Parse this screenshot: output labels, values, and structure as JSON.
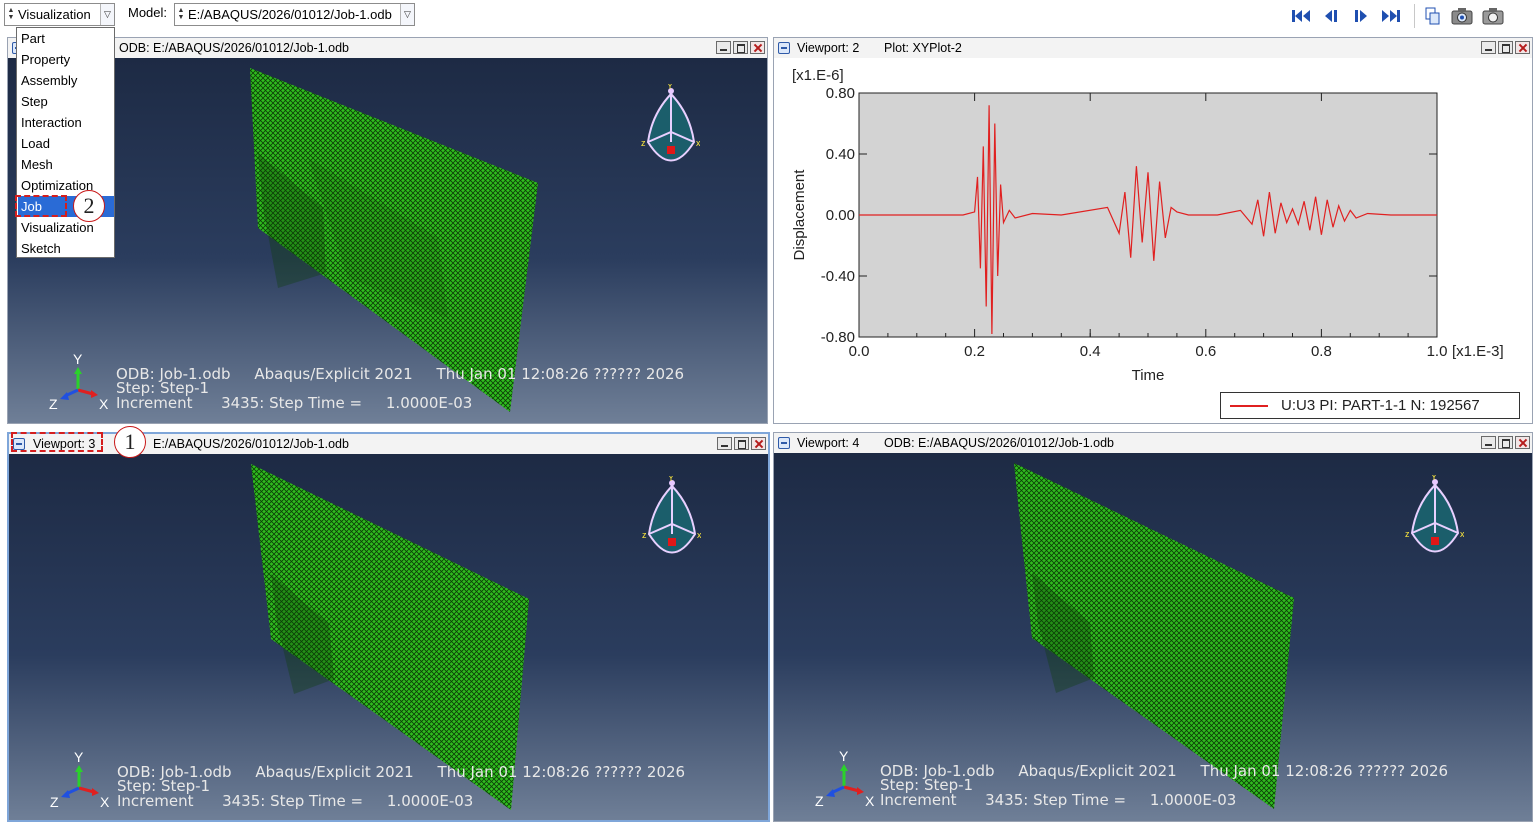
{
  "toolbar": {
    "module_value": "Visualization",
    "model_label": "Model:",
    "model_value": "E:/ABAQUS/2026/01012/Job-1.odb"
  },
  "module_menu": {
    "items": [
      "Part",
      "Property",
      "Assembly",
      "Step",
      "Interaction",
      "Load",
      "Mesh",
      "Optimization",
      "Job",
      "Visualization",
      "Sketch"
    ],
    "selected": "Job"
  },
  "annotations": {
    "callout_1": "1",
    "callout_2": "2",
    "color": "#d41e1e"
  },
  "viewports": {
    "vp1": {
      "title": "ODB: E:/ABAQUS/2026/01012/Job-1.odb",
      "info": {
        "line1": "ODB: Job-1.odb     Abaqus/Explicit 2021     Thu Jan 01 12:08:26 ?????? 2026",
        "line2": "Step: Step-1",
        "line3": "Increment      3435: Step Time =     1.0000E-03"
      }
    },
    "vp2": {
      "title_name": "Viewport: 2",
      "title_plot": "Plot: XYPlot-2"
    },
    "vp3": {
      "title_name": "Viewport: 3",
      "title_odb": "E:/ABAQUS/2026/01012/Job-1.odb",
      "info": {
        "line1": "ODB: Job-1.odb     Abaqus/Explicit 2021     Thu Jan 01 12:08:26 ?????? 2026",
        "line2": "Step: Step-1",
        "line3": "Increment      3435: Step Time =     1.0000E-03"
      }
    },
    "vp4": {
      "title_name": "Viewport: 4",
      "title_odb": "ODB: E:/ABAQUS/2026/01012/Job-1.odb",
      "info": {
        "line1": "ODB: Job-1.odb     Abaqus/Explicit 2021     Thu Jan 01 12:08:26 ?????? 2026",
        "line2": "Step: Step-1",
        "line3": "Increment      3435: Step Time =     1.0000E-03"
      }
    }
  },
  "triad": {
    "x": "X",
    "y": "Y",
    "z": "Z"
  },
  "view_cube": {
    "x": "x",
    "y": "Y",
    "z": "z"
  },
  "icons": [
    "first-frame-icon",
    "previous-frame-icon",
    "next-frame-icon",
    "last-frame-icon",
    "copy-icon",
    "camera-icon",
    "snapshot-icon"
  ],
  "chart_data": {
    "type": "line",
    "title": "",
    "xlabel": "Time",
    "ylabel": "Displacement",
    "x_scale": "[x1.E-3]",
    "y_scale": "[x1.E-6]",
    "xlim": [
      0.0,
      1.0
    ],
    "ylim": [
      -0.8,
      0.8
    ],
    "x_ticks": [
      "0.0",
      "0.2",
      "0.4",
      "0.6",
      "0.8",
      "1.0"
    ],
    "y_ticks": [
      "0.80",
      "0.40",
      "0.00",
      "-0.40",
      "-0.80"
    ],
    "grid": false,
    "legend": "bottom-right",
    "series": [
      {
        "name": "U:U3 PI: PART-1-1 N: 192567",
        "color": "#e02020",
        "x": [
          0.0,
          0.18,
          0.2,
          0.205,
          0.21,
          0.215,
          0.22,
          0.225,
          0.23,
          0.235,
          0.24,
          0.245,
          0.25,
          0.26,
          0.27,
          0.3,
          0.35,
          0.43,
          0.45,
          0.46,
          0.47,
          0.48,
          0.49,
          0.5,
          0.51,
          0.52,
          0.53,
          0.54,
          0.55,
          0.57,
          0.62,
          0.66,
          0.68,
          0.69,
          0.7,
          0.71,
          0.72,
          0.73,
          0.74,
          0.75,
          0.76,
          0.77,
          0.78,
          0.79,
          0.8,
          0.81,
          0.82,
          0.83,
          0.84,
          0.85,
          0.86,
          0.88,
          0.92,
          1.0
        ],
        "y": [
          0.0,
          0.0,
          0.02,
          0.25,
          -0.35,
          0.45,
          -0.6,
          0.72,
          -0.78,
          0.6,
          -0.4,
          0.2,
          -0.05,
          0.03,
          -0.02,
          0.01,
          0.0,
          0.05,
          -0.12,
          0.15,
          -0.28,
          0.32,
          -0.18,
          0.28,
          -0.3,
          0.22,
          -0.15,
          0.05,
          0.02,
          0.0,
          0.0,
          0.03,
          -0.06,
          0.1,
          -0.14,
          0.15,
          -0.12,
          0.08,
          -0.05,
          0.04,
          -0.06,
          0.09,
          -0.1,
          0.12,
          -0.13,
          0.1,
          -0.08,
          0.06,
          -0.04,
          0.03,
          -0.02,
          0.01,
          0.0,
          0.0
        ]
      }
    ]
  }
}
